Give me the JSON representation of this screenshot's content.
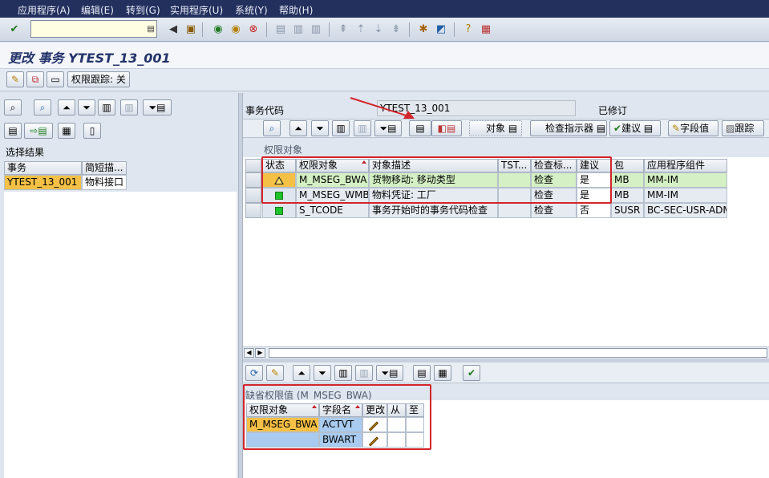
{
  "menu": [
    "应用程序(A)",
    "编辑(E)",
    "转到(G)",
    "实用程序(U)",
    "系统(Y)",
    "帮助(H)"
  ],
  "title": "更改 事务 YTEST_13_001",
  "app_toolbar": {
    "auth_trace": "权限跟踪: 关"
  },
  "left": {
    "select_result_label": "选择结果",
    "columns": [
      "事务",
      "简短描..."
    ],
    "rows": [
      [
        "YTEST_13_001",
        "物料接口"
      ]
    ]
  },
  "right": {
    "tcode_label": "事务代码",
    "tcode_value": "YTEST_13_001",
    "status": "已修订",
    "buttons": {
      "object": "对象",
      "check_indicator": "检查指示器",
      "proposal": "建议",
      "field_values": "字段值",
      "trace": "跟踪"
    },
    "auth_objects_label": "权限对象",
    "columns": [
      "状态",
      "权限对象",
      "对象描述",
      "TST...",
      "检查标...",
      "建议",
      "包",
      "应用程序组件"
    ],
    "rows": [
      {
        "status": "yellow",
        "obj": "M_MSEG_BWA",
        "desc": "货物移动: 移动类型",
        "tst": "",
        "check": "检查",
        "proposal": "是",
        "pkg": "MB",
        "comp": "MM-IM"
      },
      {
        "status": "green",
        "obj": "M_MSEG_WMB",
        "desc": "物料凭证: 工厂",
        "tst": "",
        "check": "检查",
        "proposal": "是",
        "pkg": "MB",
        "comp": "MM-IM"
      },
      {
        "status": "green",
        "obj": "S_TCODE",
        "desc": "事务开始时的事务代码检查",
        "tst": "",
        "check": "检查",
        "proposal": "否",
        "pkg": "SUSR",
        "comp": "BC-SEC-USR-ADM"
      }
    ],
    "default_values_label": "缺省权限值 (M_MSEG_BWA)",
    "dv_columns": [
      "权限对象",
      "字段名",
      "更改",
      "从",
      "至"
    ],
    "dv_rows": [
      {
        "obj": "M_MSEG_BWA",
        "field": "ACTVT"
      },
      {
        "obj": "",
        "field": "BWART"
      }
    ]
  },
  "colors": {
    "highlight_red": "#d4242a",
    "row_green": "#d4f0c4",
    "key_orange": "#f5c046",
    "key_blue": "#a8cbef"
  }
}
